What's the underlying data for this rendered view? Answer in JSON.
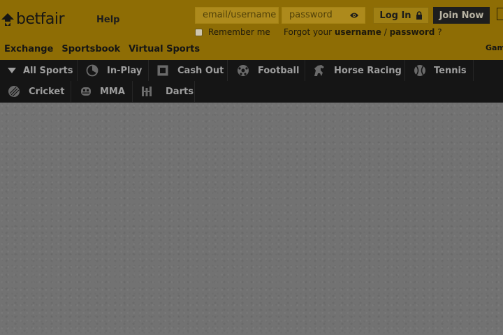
{
  "brand": {
    "logo_text": "betfair"
  },
  "header": {
    "help_label": "Help",
    "email_placeholder": "email/username",
    "password_placeholder": "password",
    "login_label": "Log In",
    "join_label": "Join Now",
    "remember_label": "Remember me",
    "forgot_prefix": "Forgot your",
    "forgot_username": "username",
    "forgot_sep": "/",
    "forgot_password": "password",
    "forgot_suffix": "?",
    "games_label": "Gam"
  },
  "topnav": {
    "items": [
      {
        "label": "Exchange"
      },
      {
        "label": "Sportsbook"
      },
      {
        "label": "Virtual Sports"
      }
    ]
  },
  "sportsnav": {
    "items": [
      {
        "label": "All Sports",
        "icon": "caret-down-icon"
      },
      {
        "label": "In-Play",
        "icon": "in-play-icon"
      },
      {
        "label": "Cash Out",
        "icon": "cash-out-icon"
      },
      {
        "label": "Football",
        "icon": "football-icon"
      },
      {
        "label": "Horse Racing",
        "icon": "horse-racing-icon"
      },
      {
        "label": "Tennis",
        "icon": "tennis-icon"
      },
      {
        "label": "Cricket",
        "icon": "cricket-icon"
      },
      {
        "label": "MMA",
        "icon": "mma-icon"
      },
      {
        "label": "Darts",
        "icon": "darts-icon"
      }
    ]
  },
  "colors": {
    "header_bg": "#8e6d05",
    "nav_bg": "#151515",
    "body_bg": "#727272"
  }
}
